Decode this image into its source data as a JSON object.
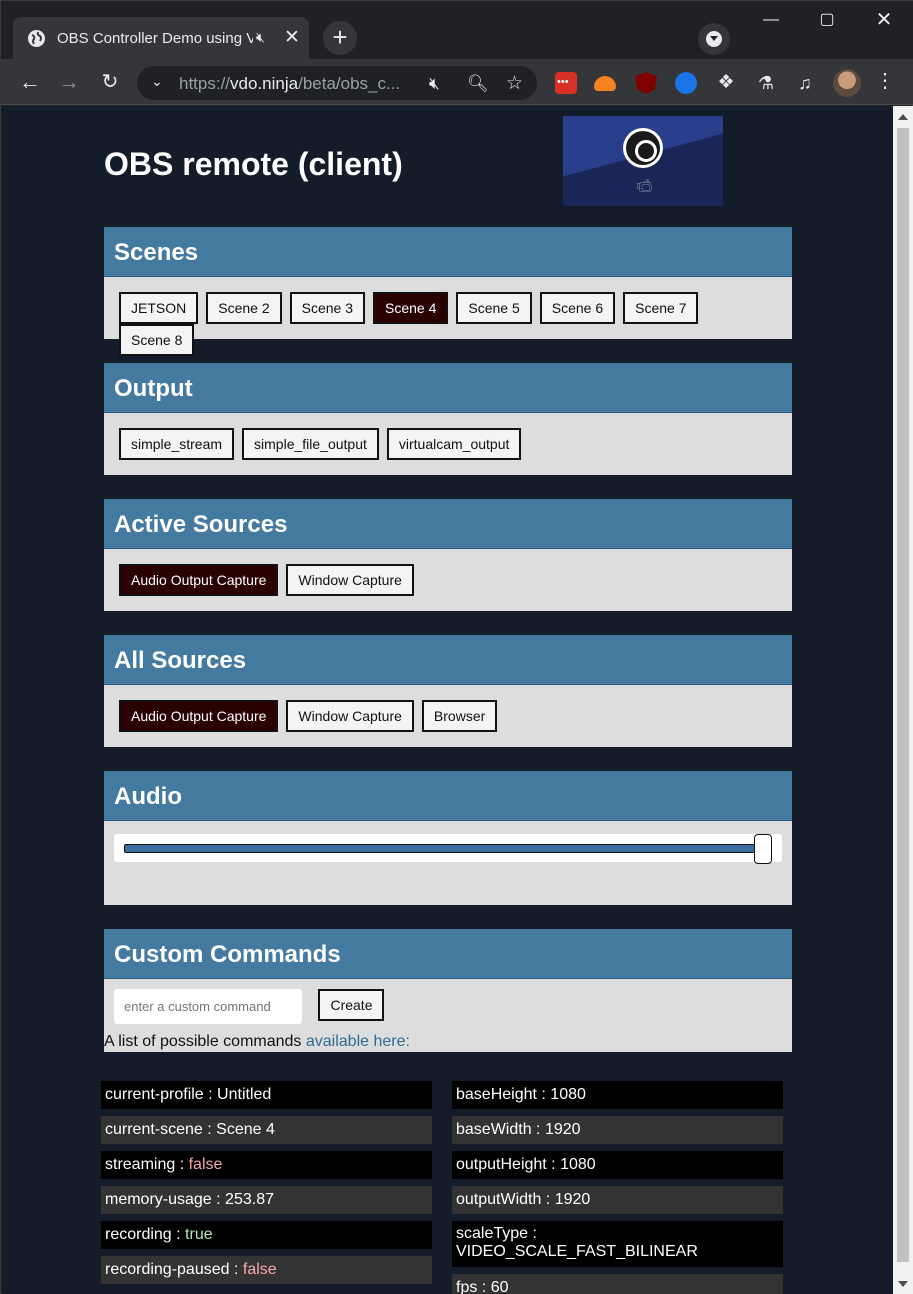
{
  "browser": {
    "tab_title": "OBS Controller Demo using VDO.Ninja",
    "url_host": "vdo.ninja",
    "url_prefix": "https://",
    "url_path": "/beta/obs_c..."
  },
  "page": {
    "title": "OBS remote (client)"
  },
  "scenes": {
    "heading": "Scenes",
    "buttons": [
      "JETSON",
      "Scene 2",
      "Scene 3",
      "Scene 4",
      "Scene 5",
      "Scene 6",
      "Scene 7",
      "Scene 8"
    ],
    "active": "Scene 4"
  },
  "output": {
    "heading": "Output",
    "buttons": [
      "simple_stream",
      "simple_file_output",
      "virtualcam_output"
    ]
  },
  "active_sources": {
    "heading": "Active Sources",
    "buttons": [
      "Audio Output Capture",
      "Window Capture"
    ],
    "active": "Audio Output Capture"
  },
  "all_sources": {
    "heading": "All Sources",
    "buttons": [
      "Audio Output Capture",
      "Window Capture",
      "Browser"
    ],
    "active": "Audio Output Capture"
  },
  "audio": {
    "heading": "Audio",
    "volume_level": 1.0
  },
  "custom_commands": {
    "heading": "Custom Commands",
    "input_placeholder": "enter a custom command",
    "create_label": "Create",
    "note_text": "A list of possible commands ",
    "note_link": "available here:"
  },
  "stats_left": [
    {
      "key": "current-profile",
      "value": "Untitled",
      "state": "plain"
    },
    {
      "key": "current-scene",
      "value": "Scene 4",
      "state": "plain"
    },
    {
      "key": "streaming",
      "value": "false",
      "state": "false"
    },
    {
      "key": "memory-usage",
      "value": "253.87",
      "state": "plain"
    },
    {
      "key": "recording",
      "value": "true",
      "state": "true"
    },
    {
      "key": "recording-paused",
      "value": "false",
      "state": "false"
    }
  ],
  "stats_right": [
    {
      "key": "baseHeight",
      "value": "1080",
      "state": "plain"
    },
    {
      "key": "baseWidth",
      "value": "1920",
      "state": "plain"
    },
    {
      "key": "outputHeight",
      "value": "1080",
      "state": "plain"
    },
    {
      "key": "outputWidth",
      "value": "1920",
      "state": "plain"
    },
    {
      "key": "scaleType",
      "value": "VIDEO_SCALE_FAST_BILINEAR",
      "state": "plain"
    },
    {
      "key": "fps",
      "value": "60",
      "state": "plain"
    }
  ],
  "colors": {
    "panel_header": "#457aa0",
    "panel_body": "#dddddd",
    "page_bg": "#141b29",
    "active_button": "#2b0000",
    "false_value": "#f7a8a8",
    "true_value": "#b6e8b6"
  }
}
